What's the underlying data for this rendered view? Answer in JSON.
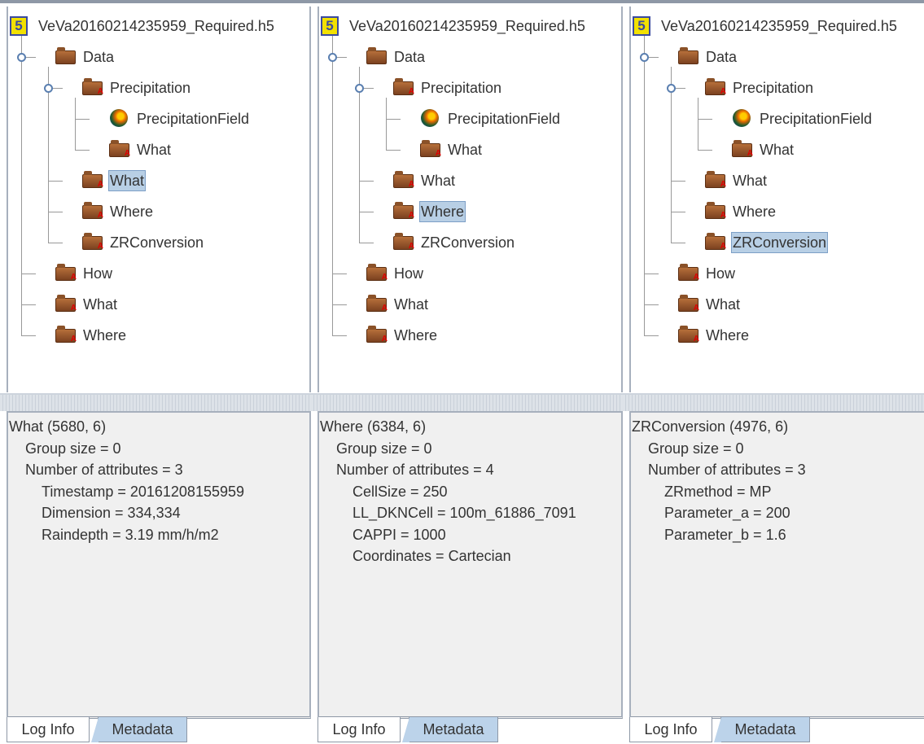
{
  "panels": [
    {
      "title": "VeVa20160214235959_Required.h5",
      "tree": {
        "data": "Data",
        "precipitation": "Precipitation",
        "precipitation_field": "PrecipitationField",
        "precip_what": "What",
        "data_what": "What",
        "data_where": "Where",
        "zrconversion": "ZRConversion",
        "how": "How",
        "what": "What",
        "where": "Where"
      },
      "selected": "data_what",
      "info": {
        "header": "What (5680, 6)",
        "group_size": "Group size = 0",
        "num_attrs": "Number of attributes = 3",
        "attributes": [
          "Timestamp = 20161208155959",
          "Dimension = 334,334",
          "Raindepth = 3.19 mm/h/m2"
        ]
      },
      "tabs": [
        "Log Info",
        "Metadata"
      ]
    },
    {
      "title": "VeVa20160214235959_Required.h5",
      "tree": {
        "data": "Data",
        "precipitation": "Precipitation",
        "precipitation_field": "PrecipitationField",
        "precip_what": "What",
        "data_what": "What",
        "data_where": "Where",
        "zrconversion": "ZRConversion",
        "how": "How",
        "what": "What",
        "where": "Where"
      },
      "selected": "data_where",
      "info": {
        "header": "Where (6384, 6)",
        "group_size": "Group size = 0",
        "num_attrs": "Number of attributes = 4",
        "attributes": [
          "CellSize = 250",
          "LL_DKNCell = 100m_61886_7091",
          "CAPPI = 1000",
          "Coordinates = Cartecian"
        ]
      },
      "tabs": [
        "Log Info",
        "Metadata"
      ]
    },
    {
      "title": "VeVa20160214235959_Required.h5",
      "tree": {
        "data": "Data",
        "precipitation": "Precipitation",
        "precipitation_field": "PrecipitationField",
        "precip_what": "What",
        "data_what": "What",
        "data_where": "Where",
        "zrconversion": "ZRConversion",
        "how": "How",
        "what": "What",
        "where": "Where"
      },
      "selected": "zrconversion",
      "info": {
        "header": "ZRConversion (4976, 6)",
        "group_size": "Group size = 0",
        "num_attrs": "Number of attributes = 3",
        "attributes": [
          "ZRmethod = MP",
          "Parameter_a = 200",
          "Parameter_b = 1.6"
        ]
      },
      "tabs": [
        "Log Info",
        "Metadata"
      ]
    }
  ],
  "icons": {
    "file": "hdf5-file-icon",
    "group": "group-folder-icon",
    "dataset": "dataset-globe-icon"
  },
  "colors": {
    "selection": "#b8cfe5",
    "metadata_tab": "#bcd3ea",
    "info_bg": "#f0f0f0"
  }
}
